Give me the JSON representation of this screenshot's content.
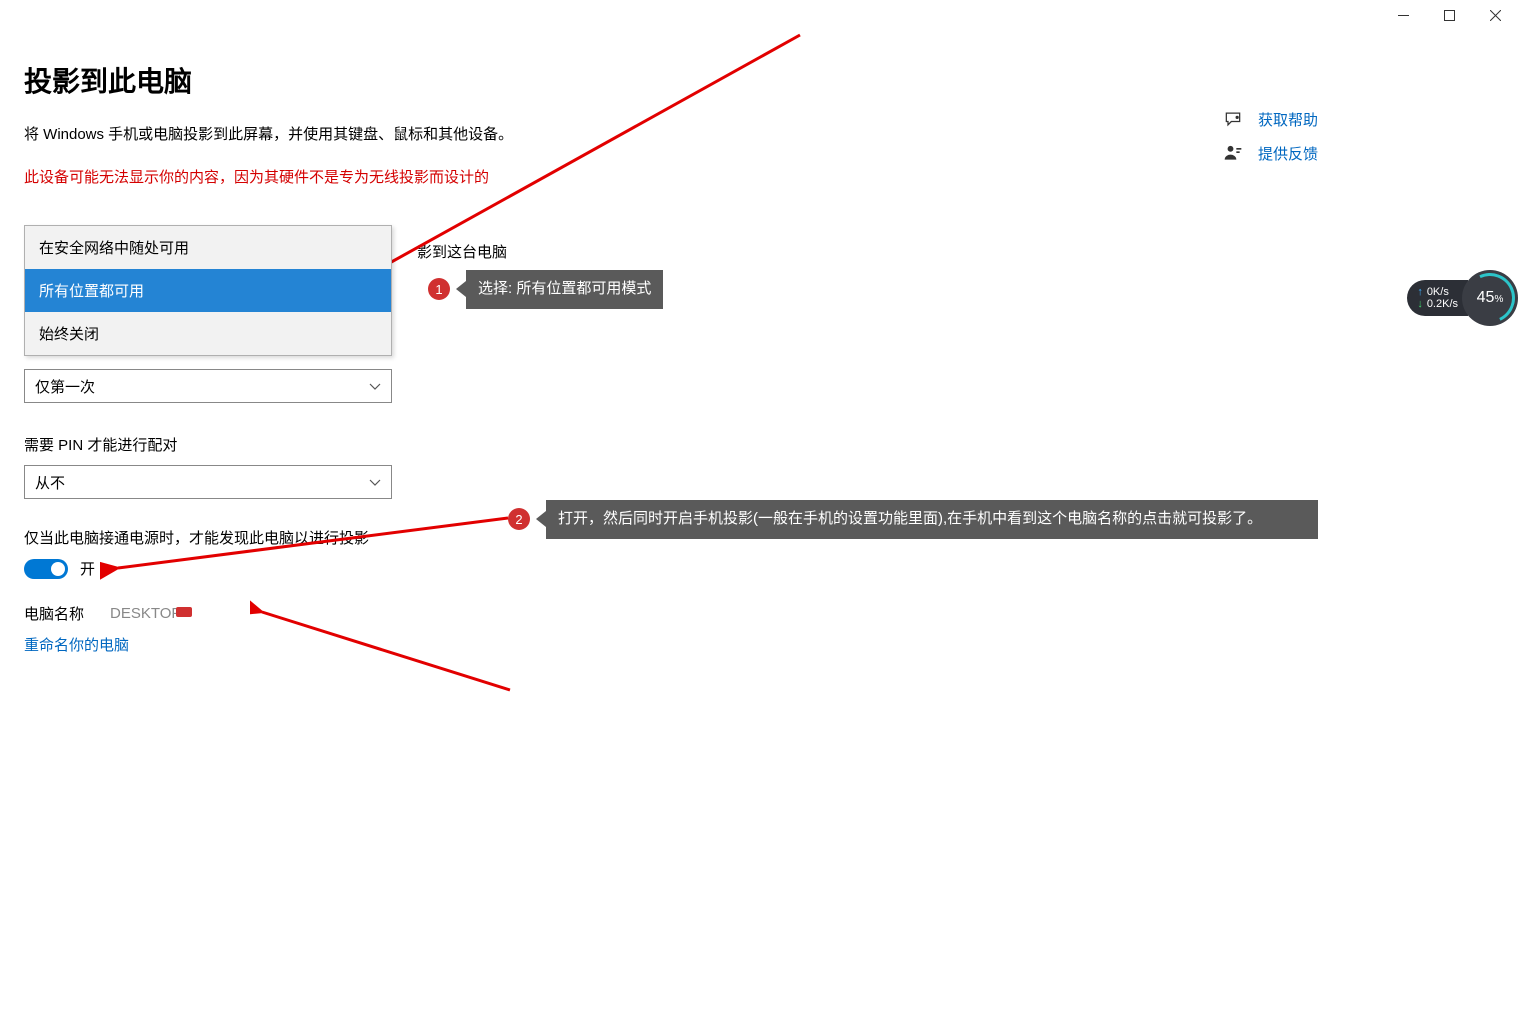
{
  "window_controls": {
    "minimize": "−",
    "maximize": "□",
    "close": "✕"
  },
  "page": {
    "title": "投影到此电脑",
    "description": "将 Windows 手机或电脑投影到此屏幕，并使用其键盘、鼠标和其他设备。",
    "warning": "此设备可能无法显示你的内容，因为其硬件不是专为无线投影而设计的",
    "truncated_right": "影到这台电脑"
  },
  "dropdown1": {
    "options": [
      "在安全网络中随处可用",
      "所有位置都可用",
      "始终关闭"
    ],
    "selected_index": 1
  },
  "section2": {
    "label_fragment": "要求投影到这台电脑",
    "value": "仅第一次"
  },
  "section3": {
    "label": "需要 PIN 才能进行配对",
    "value": "从不"
  },
  "section4": {
    "label": "仅当此电脑接通电源时，才能发现此电脑以进行投影",
    "toggle_state": "开"
  },
  "section5": {
    "label": "电脑名称",
    "value": "DESKTOP-",
    "rename_link": "重命名你的电脑"
  },
  "help": {
    "get_help": "获取帮助",
    "feedback": "提供反馈"
  },
  "callouts": {
    "c1": "选择: 所有位置都可用模式",
    "c2": "打开，然后同时开启手机投影(一般在手机的设置功能里面),在手机中看到这个电脑名称的点击就可投影了。"
  },
  "netspeed": {
    "up": "0K/s",
    "down": "0.2K/s",
    "percent": "45",
    "percent_suffix": "%"
  },
  "badges": {
    "b1": "1",
    "b2": "2"
  }
}
